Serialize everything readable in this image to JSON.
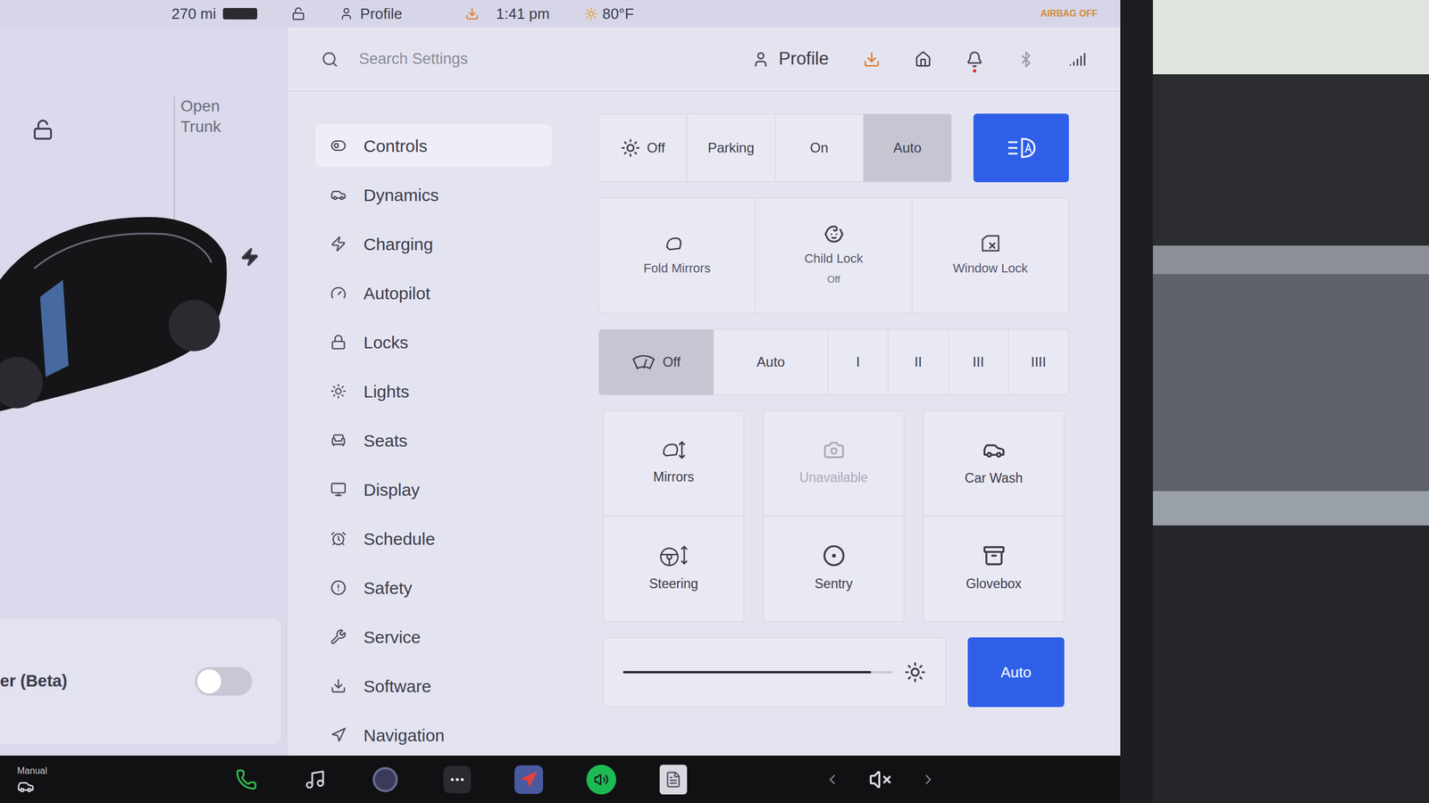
{
  "status_bar": {
    "range": "270 mi",
    "profile": "Profile",
    "time": "1:41 pm",
    "temperature": "80°F",
    "airbag": "AIRBAG OFF"
  },
  "car_panel": {
    "trunk": "Open Trunk",
    "locked": false,
    "charging": true,
    "feature": "er (Beta)",
    "feature_on": false
  },
  "settings_header": {
    "search_placeholder": "Search Settings",
    "profile": "Profile",
    "notification": true
  },
  "sidebar": {
    "items": [
      {
        "label": "Controls",
        "selected": true
      },
      {
        "label": "Dynamics",
        "selected": false
      },
      {
        "label": "Charging",
        "selected": false
      },
      {
        "label": "Autopilot",
        "selected": false
      },
      {
        "label": "Locks",
        "selected": false
      },
      {
        "label": "Lights",
        "selected": false
      },
      {
        "label": "Seats",
        "selected": false
      },
      {
        "label": "Display",
        "selected": false
      },
      {
        "label": "Schedule",
        "selected": false
      },
      {
        "label": "Safety",
        "selected": false
      },
      {
        "label": "Service",
        "selected": false
      },
      {
        "label": "Software",
        "selected": false
      },
      {
        "label": "Navigation",
        "selected": false
      }
    ]
  },
  "headlights": {
    "options": [
      {
        "label": "Off",
        "selected": false
      },
      {
        "label": "Parking",
        "selected": false
      },
      {
        "label": "On",
        "selected": false
      },
      {
        "label": "Auto",
        "selected": true
      }
    ],
    "auto_high_beam": true
  },
  "quick_controls": [
    {
      "label": "Fold Mirrors"
    },
    {
      "label": "Child Lock",
      "status": "Off"
    },
    {
      "label": "Window Lock"
    }
  ],
  "wipers": [
    {
      "label": "Off",
      "selected": true
    },
    {
      "label": "Auto",
      "selected": false
    },
    {
      "label": "I",
      "selected": false
    },
    {
      "label": "II",
      "selected": false
    },
    {
      "label": "III",
      "selected": false
    },
    {
      "label": "IIII",
      "selected": false
    }
  ],
  "tiles": [
    {
      "label": "Mirrors",
      "disabled": false
    },
    {
      "label": "Unavailable",
      "disabled": true
    },
    {
      "label": "Car Wash",
      "disabled": false
    },
    {
      "label": "Steering",
      "disabled": false
    },
    {
      "label": "Sentry",
      "disabled": false
    },
    {
      "label": "Glovebox",
      "disabled": false
    }
  ],
  "brightness": {
    "level": 0.92,
    "auto": {
      "label": "Auto",
      "selected": true
    }
  },
  "taskbar": {
    "drive_mode": "Manual",
    "muted": true
  }
}
